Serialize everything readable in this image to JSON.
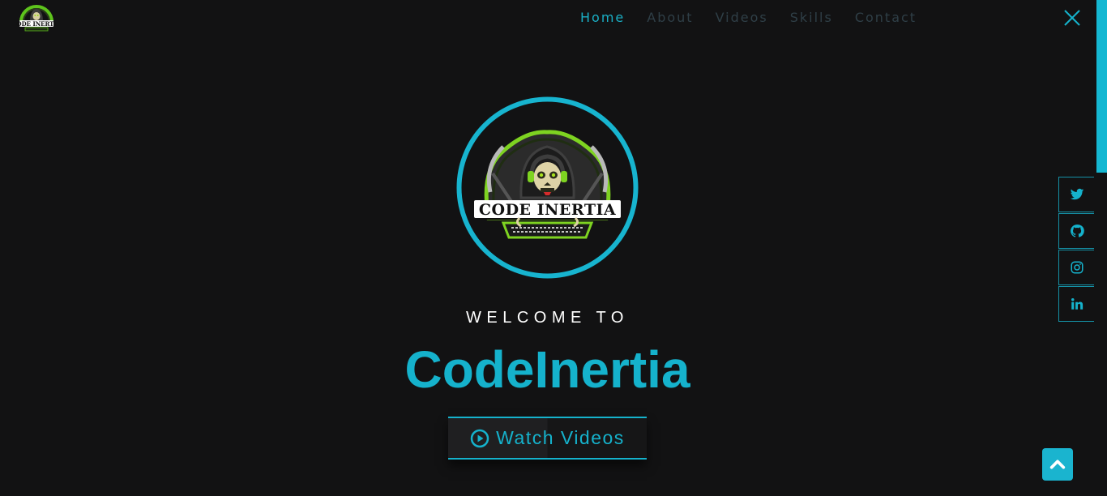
{
  "header": {
    "logo_text": "CODE INERTIA",
    "nav": [
      {
        "label": "Home",
        "active": true
      },
      {
        "label": "About",
        "active": false
      },
      {
        "label": "Videos",
        "active": false
      },
      {
        "label": "Skills",
        "active": false
      },
      {
        "label": "Contact",
        "active": false
      }
    ],
    "close_icon": "close-icon"
  },
  "hero": {
    "logo_text": "CODE INERTIA",
    "welcome": "WELCOME TO",
    "brand": "CodeInertia",
    "cta_label": "Watch Videos",
    "cta_icon": "play-circle-icon"
  },
  "social": [
    {
      "name": "twitter",
      "icon": "twitter-icon"
    },
    {
      "name": "github",
      "icon": "github-icon"
    },
    {
      "name": "instagram",
      "icon": "instagram-icon"
    },
    {
      "name": "linkedin",
      "icon": "linkedin-icon"
    }
  ],
  "colors": {
    "accent": "#15b2cc",
    "background": "#121213",
    "nav_inactive": "#2f3f47",
    "logo_green": "#7ed321"
  },
  "scroll_to_top_icon": "chevron-up-icon"
}
